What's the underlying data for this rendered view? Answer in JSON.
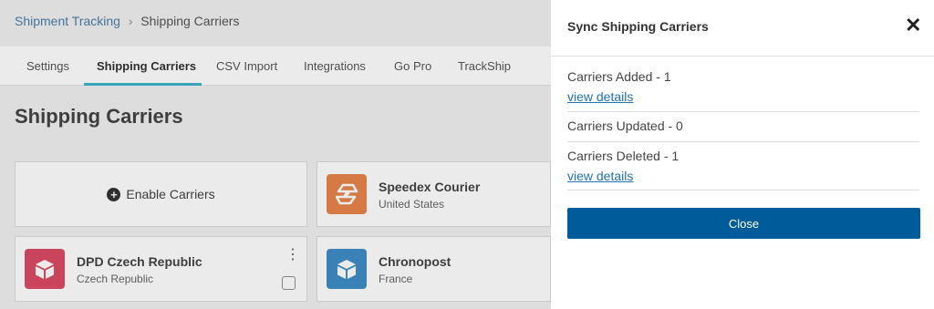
{
  "breadcrumb": {
    "parent": "Shipment Tracking",
    "separator": "›",
    "current": "Shipping Carriers"
  },
  "tabs": [
    {
      "label": "Settings"
    },
    {
      "label": "Shipping Carriers"
    },
    {
      "label": "CSV Import"
    },
    {
      "label": "Integrations"
    },
    {
      "label": "Go Pro"
    },
    {
      "label": "TrackShip"
    }
  ],
  "page_title": "Shipping Carriers",
  "enable_carriers_label": "Enable Carriers",
  "carriers": [
    {
      "name": "Speedex Courier",
      "country": "United States",
      "logo_color": "#e8854a"
    },
    {
      "name": "DPD Czech Republic",
      "country": "Czech Republic",
      "logo_color": "#dc4a63"
    },
    {
      "name": "Chronopost",
      "country": "France",
      "logo_color": "#3f8cc8"
    }
  ],
  "kebab_icon": "⋮",
  "dialog": {
    "title": "Sync Shipping Carriers",
    "close_icon": "✕",
    "added": "Carriers Added - 1",
    "added_link": "view details",
    "updated": "Carriers Updated - 0",
    "deleted": "Carriers Deleted - 1",
    "deleted_link": "view details",
    "close_button": "Close"
  }
}
